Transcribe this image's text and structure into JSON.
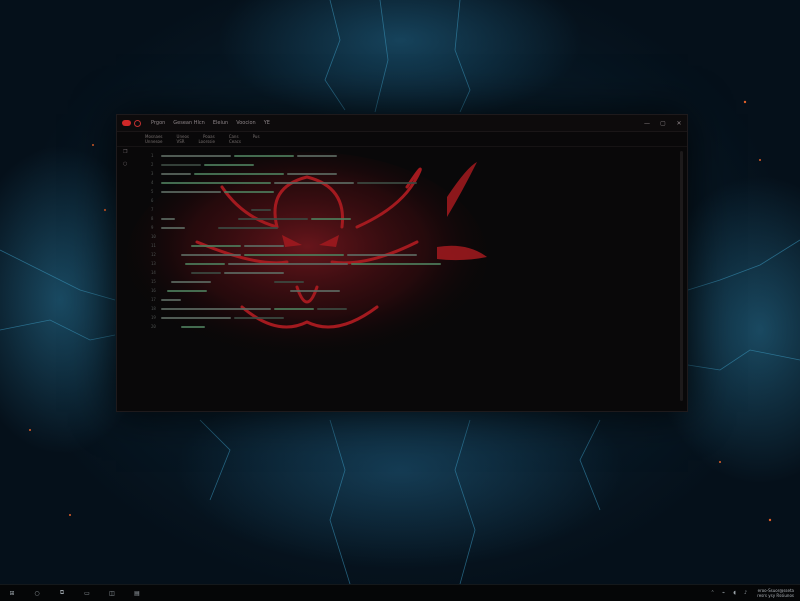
{
  "window": {
    "app_icon": "app-logo-icon",
    "menu": [
      "Prgon",
      "Gesean Hlcn",
      "Eleiun",
      "Voocion",
      "YE"
    ],
    "controls": [
      "—",
      "▢",
      "✕"
    ]
  },
  "toolbar": {
    "row1": [
      "Mosnaes",
      "Uneos",
      "Poaas",
      "Cans",
      "Pus"
    ],
    "row2": [
      "Unnesoe",
      "VSR",
      "Loorssie",
      "Ceacs"
    ]
  },
  "gutter_icons": [
    "❐",
    "○"
  ],
  "code": {
    "line_numbers": [
      "1",
      "2",
      "3",
      "4",
      "5",
      "6",
      "7",
      "8",
      "9",
      "10",
      "11",
      "12",
      "13",
      "14",
      "15",
      "16",
      "17",
      "18",
      "19",
      "20"
    ]
  },
  "taskbar": {
    "items": [
      "start-icon",
      "search-icon",
      "task-view-icon",
      "file-explorer-icon",
      "browser-icon",
      "terminal-icon"
    ],
    "glyphs": [
      "⊞",
      "○",
      "⧉",
      "▭",
      "◫",
      "▤"
    ],
    "tray_glyphs": [
      "⌃",
      "⌁",
      "◖",
      "♪"
    ],
    "clock_line1": "eroo-Ssuor@sseta",
    "clock_line2": "resrs ysy Rssiunos"
  },
  "colors": {
    "accent": "#d02828",
    "emblem": "#a31a1f",
    "desktop_glow": "#2e86b0"
  }
}
